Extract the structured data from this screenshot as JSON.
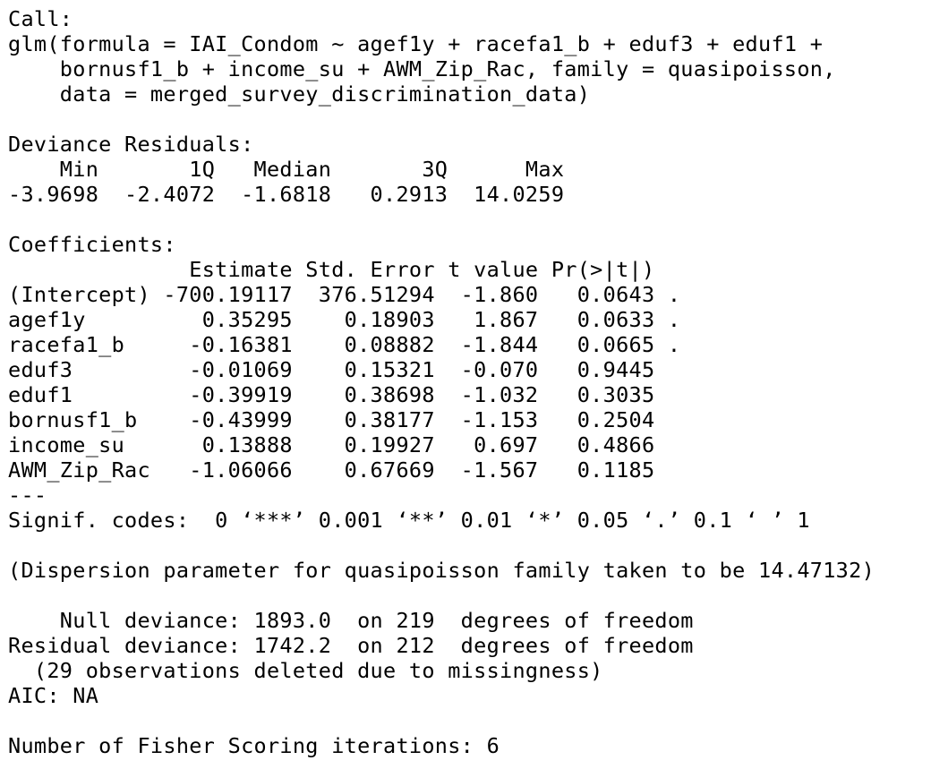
{
  "console": {
    "lines": [
      "Call:",
      "glm(formula = IAI_Condom ~ agef1y + racefa1_b + eduf3 + eduf1 +",
      "    bornusf1_b + income_su + AWM_Zip_Rac, family = quasipoisson,",
      "    data = merged_survey_discrimination_data)",
      "",
      "Deviance Residuals:",
      "    Min       1Q   Median       3Q      Max",
      "-3.9698  -2.4072  -1.6818   0.2913  14.0259",
      "",
      "Coefficients:",
      "              Estimate Std. Error t value Pr(>|t|)",
      "(Intercept) -700.19117  376.51294  -1.860   0.0643 .",
      "agef1y         0.35295    0.18903   1.867   0.0633 .",
      "racefa1_b     -0.16381    0.08882  -1.844   0.0665 .",
      "eduf3         -0.01069    0.15321  -0.070   0.9445",
      "eduf1         -0.39919    0.38698  -1.032   0.3035",
      "bornusf1_b    -0.43999    0.38177  -1.153   0.2504",
      "income_su      0.13888    0.19927   0.697   0.4866",
      "AWM_Zip_Rac   -1.06066    0.67669  -1.567   0.1185",
      "---",
      "Signif. codes:  0 ‘***’ 0.001 ‘**’ 0.01 ‘*’ 0.05 ‘.’ 0.1 ‘ ’ 1",
      "",
      "(Dispersion parameter for quasipoisson family taken to be 14.47132)",
      "",
      "    Null deviance: 1893.0  on 219  degrees of freedom",
      "Residual deviance: 1742.2  on 212  degrees of freedom",
      "  (29 observations deleted due to missingness)",
      "AIC: NA",
      "",
      "Number of Fisher Scoring iterations: 6"
    ]
  }
}
